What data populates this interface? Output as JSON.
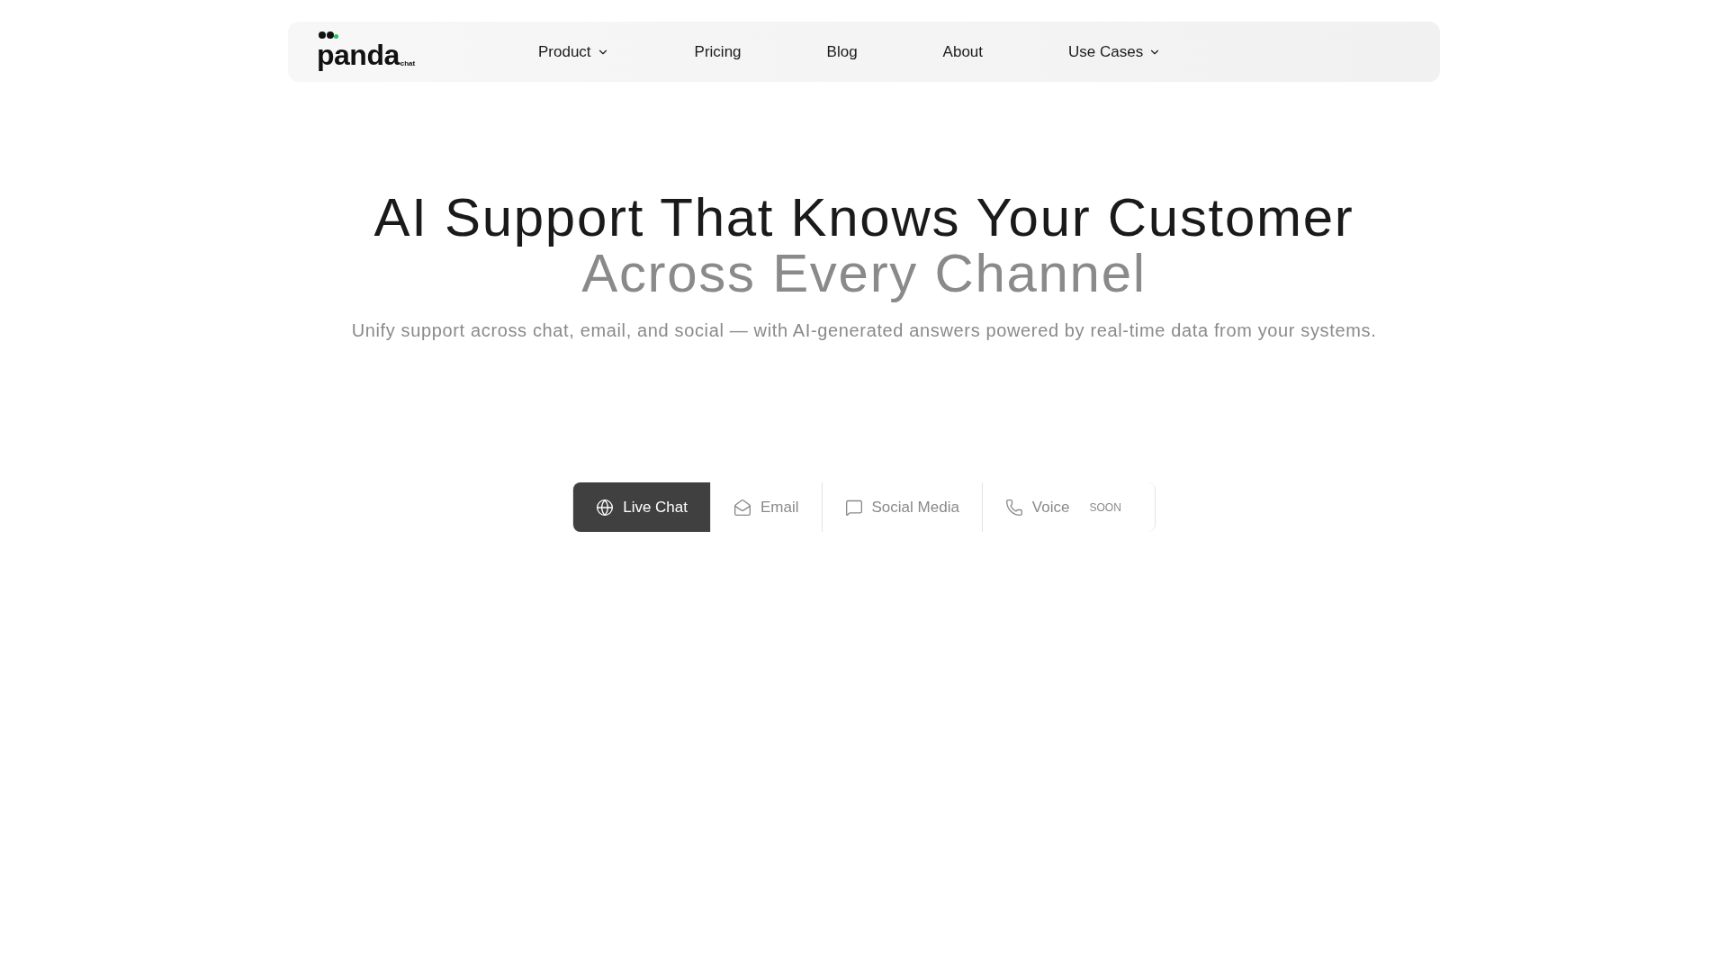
{
  "nav": {
    "logo": {
      "name": "panda",
      "sub": "chat"
    },
    "items": [
      {
        "label": "Product",
        "dropdown": true
      },
      {
        "label": "Pricing",
        "dropdown": false
      },
      {
        "label": "Blog",
        "dropdown": false
      },
      {
        "label": "About",
        "dropdown": false
      },
      {
        "label": "Use Cases",
        "dropdown": true
      }
    ]
  },
  "hero": {
    "title": "AI Support That Knows Your Customer",
    "title_accent": "Across Every Channel",
    "subtitle": "Unify support across chat, email, and social — with AI-generated answers powered by real-time data from your systems."
  },
  "channel_tabs": [
    {
      "kind": "chat",
      "label": "Live Chat",
      "selected": true
    },
    {
      "kind": "email",
      "label": "Email",
      "selected": false
    },
    {
      "kind": "social",
      "label": "Social Media",
      "selected": false
    },
    {
      "kind": "voice",
      "label": "Voice",
      "selected": false,
      "badge": "SOON"
    }
  ]
}
